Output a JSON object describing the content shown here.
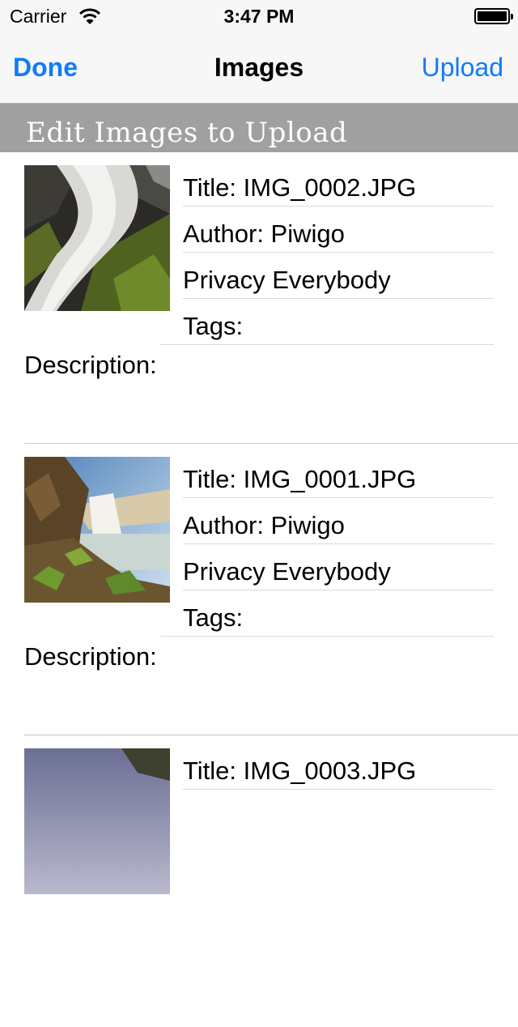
{
  "status_bar": {
    "carrier": "Carrier",
    "time": "3:47 PM"
  },
  "nav": {
    "left_button": "Done",
    "title": "Images",
    "right_button": "Upload",
    "accent_color": "#127cf6"
  },
  "section_header": {
    "title": "Edit Images to Upload"
  },
  "images": [
    {
      "title": "Title: IMG_0002.JPG",
      "author": "Author: Piwigo",
      "privacy": "Privacy Everybody",
      "tags": "Tags:",
      "description": "Description:",
      "thumbnail": "waterfall-moss-rocks"
    },
    {
      "title": "Title: IMG_0001.JPG",
      "author": "Author: Piwigo",
      "privacy": "Privacy Everybody",
      "tags": "Tags:",
      "description": "Description:",
      "thumbnail": "waterfall-cliff-sunlight"
    },
    {
      "title": "Title: IMG_0003.JPG",
      "thumbnail": "landscape-sky"
    }
  ]
}
